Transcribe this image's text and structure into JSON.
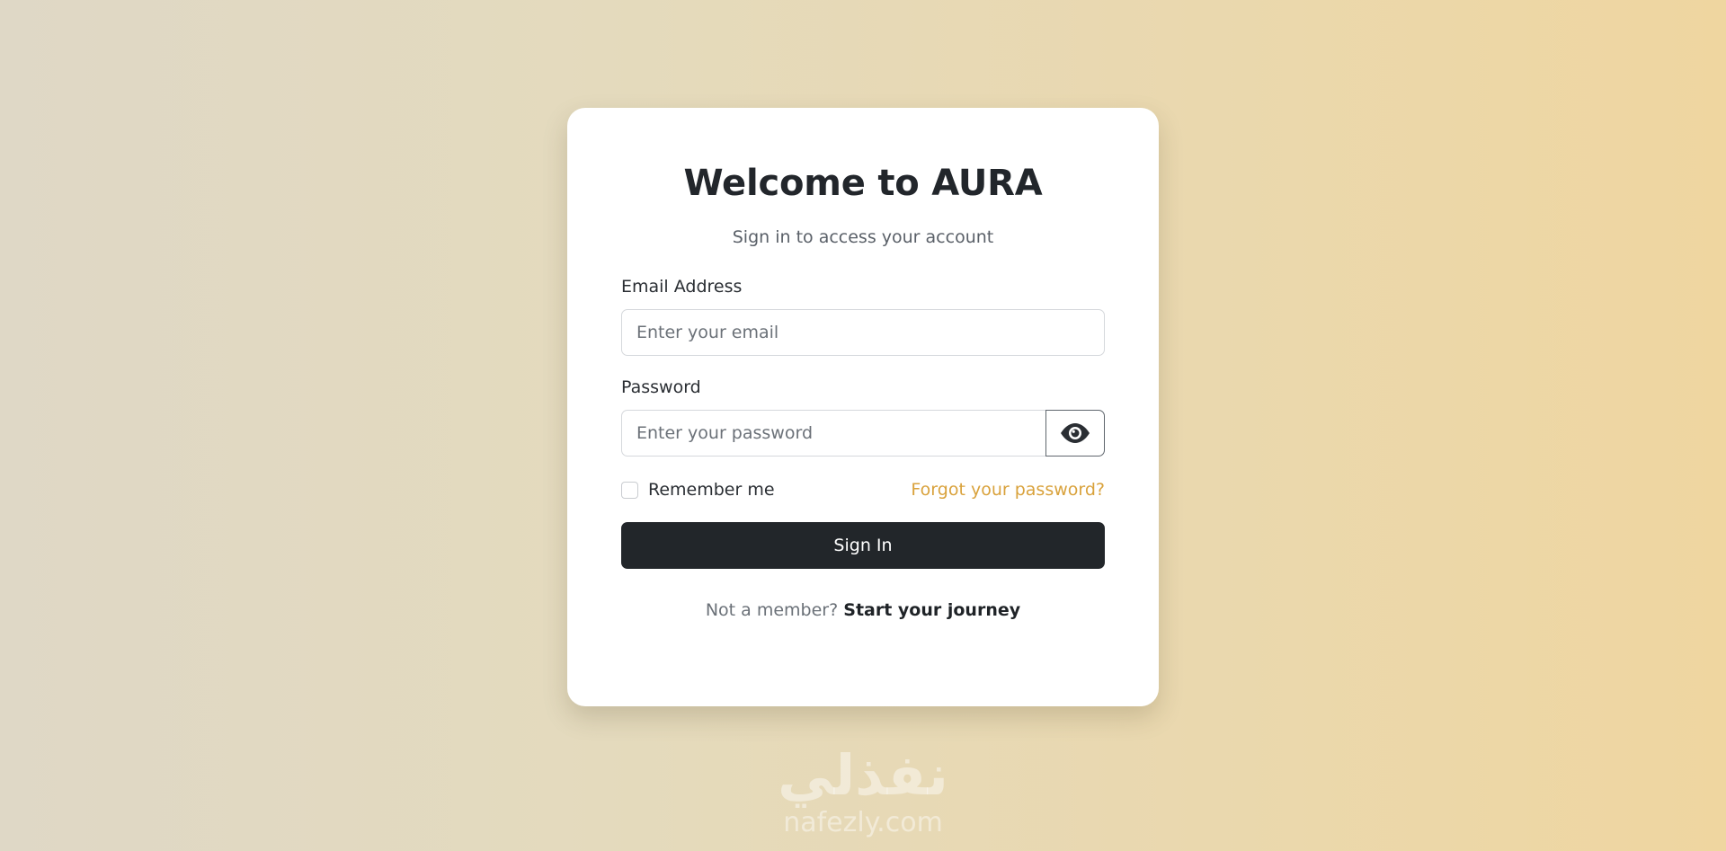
{
  "login": {
    "title": "Welcome to AURA",
    "subtitle": "Sign in to access your account",
    "email": {
      "label": "Email Address",
      "placeholder": "Enter your email",
      "value": ""
    },
    "password": {
      "label": "Password",
      "placeholder": "Enter your password",
      "value": "",
      "toggle_icon": "eye-icon"
    },
    "remember_label": "Remember me",
    "remember_checked": false,
    "forgot_label": "Forgot your password?",
    "signin_label": "Sign In",
    "footer_question": "Not a member?",
    "footer_link": "Start your journey"
  },
  "watermark": {
    "arabic": "نفذلي",
    "latin": "nafezly.com"
  },
  "colors": {
    "accent": "#d9a23c",
    "button": "#22262a",
    "title": "#22262b"
  }
}
